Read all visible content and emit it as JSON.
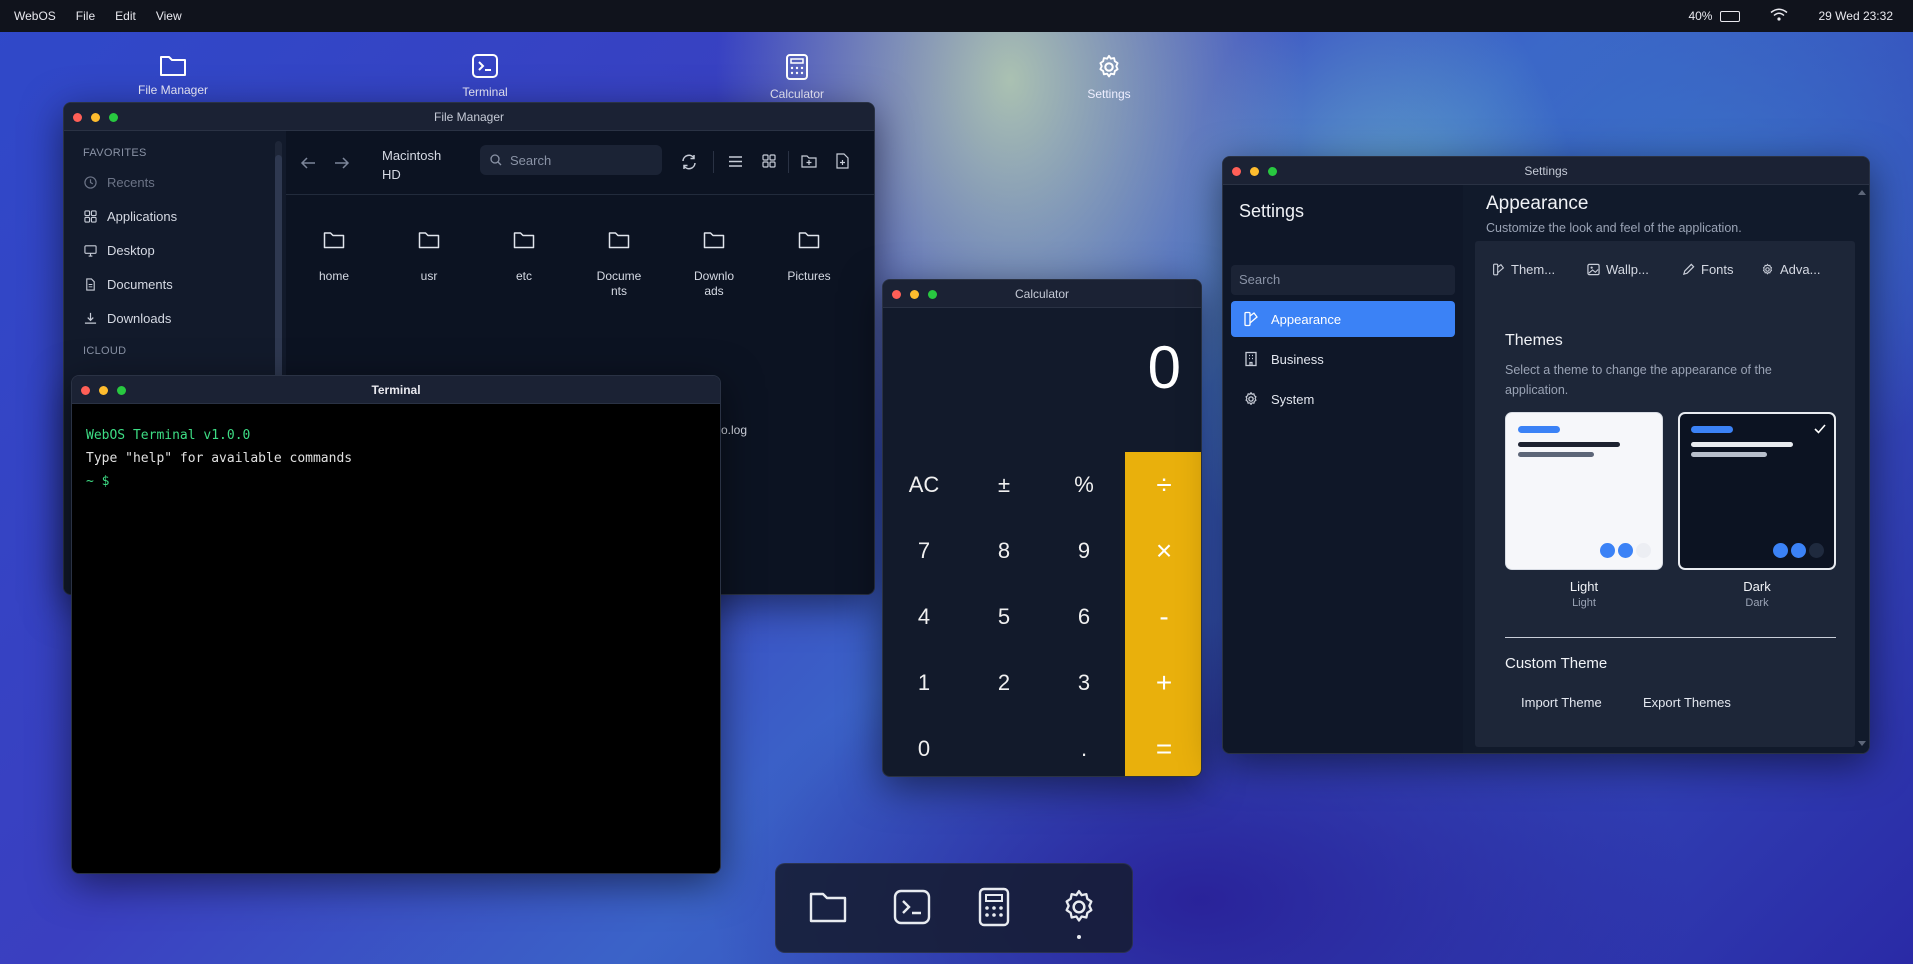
{
  "menubar": {
    "app": "WebOS",
    "items": [
      "File",
      "Edit",
      "View"
    ],
    "battery": "40%",
    "datetime": "29 Wed 23:32"
  },
  "desktop_icons": [
    {
      "label": "File Manager",
      "icon": "folder-icon"
    },
    {
      "label": "Terminal",
      "icon": "terminal-icon"
    },
    {
      "label": "Calculator",
      "icon": "calculator-icon"
    },
    {
      "label": "Settings",
      "icon": "gear-icon"
    }
  ],
  "file_manager": {
    "title": "File Manager",
    "sidebar": {
      "favorites_header": "FAVORITES",
      "items": [
        "Recents",
        "Applications",
        "Desktop",
        "Documents",
        "Downloads"
      ],
      "icloud_header": "ICLOUD"
    },
    "toolbar": {
      "location_line1": "Macintosh",
      "location_line2": "HD",
      "search_placeholder": "Search"
    },
    "folders": [
      {
        "line1": "home",
        "line2": ""
      },
      {
        "line1": "usr",
        "line2": ""
      },
      {
        "line1": "etc",
        "line2": ""
      },
      {
        "line1": "Docume",
        "line2": "nts"
      },
      {
        "line1": "Downlo",
        "line2": "ads"
      },
      {
        "line1": "Pictures",
        "line2": ""
      }
    ],
    "partial_file": "o.log"
  },
  "terminal": {
    "title": "Terminal",
    "lines": [
      "WebOS Terminal v1.0.0",
      "Type \"help\" for available commands"
    ],
    "prompt": "~ $"
  },
  "calculator": {
    "title": "Calculator",
    "display": "0",
    "keys": [
      "AC",
      "±",
      "%",
      "÷",
      "7",
      "8",
      "9",
      "×",
      "4",
      "5",
      "6",
      "-",
      "1",
      "2",
      "3",
      "+",
      "0",
      ".",
      "="
    ]
  },
  "settings": {
    "title": "Settings",
    "sidebar_title": "Settings",
    "search_placeholder": "Search",
    "nav": [
      "Appearance",
      "Business",
      "System"
    ],
    "page_title": "Appearance",
    "page_subtitle": "Customize the look and feel of the application.",
    "tabs": [
      "Them...",
      "Wallp...",
      "Fonts",
      "Adva..."
    ],
    "themes_header": "Themes",
    "themes_desc_line1": "Select a theme to change the appearance of the",
    "themes_desc_line2": "application.",
    "theme_light": {
      "name": "Light",
      "sub": "Light"
    },
    "theme_dark": {
      "name": "Dark",
      "sub": "Dark"
    },
    "custom_header": "Custom Theme",
    "import_label": "Import Theme",
    "export_label": "Export Themes",
    "accent": "#3b82f6"
  },
  "dock": [
    "folder-icon",
    "terminal-icon",
    "calculator-icon",
    "gear-icon"
  ]
}
